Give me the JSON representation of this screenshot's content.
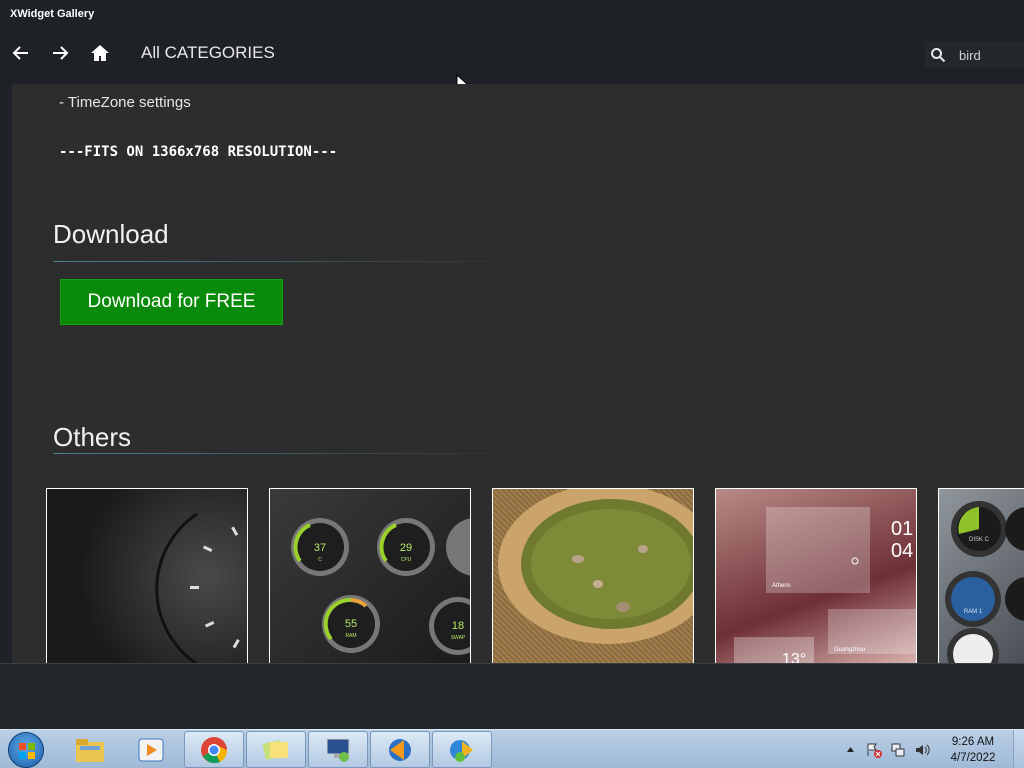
{
  "window": {
    "title": "XWidget Gallery"
  },
  "nav": {
    "category": "All CATEGORIES",
    "search_value": "bird"
  },
  "content": {
    "timezone_line": "- TimeZone settings",
    "resolution_line": "---FITS ON 1366x768 RESOLUTION---",
    "download_heading": "Download",
    "download_button": "Download for FREE",
    "others_heading": "Others",
    "thumbnails": [
      {
        "icon": "dark-clock-widget"
      },
      {
        "icon": "system-gauges-widget",
        "labels": [
          "37",
          "C",
          "29",
          "CPU",
          "55",
          "RAM",
          "18",
          "SWAP"
        ]
      },
      {
        "icon": "herbs-bowl-widget"
      },
      {
        "icon": "weather-clock-widget",
        "labels": [
          "Athens",
          "13°",
          "Guangzhou",
          "01",
          "04"
        ]
      },
      {
        "icon": "disk-meters-widget",
        "labels": [
          "DISK C",
          "RAM 1"
        ]
      }
    ]
  },
  "taskbar": {
    "items": [
      "start-button",
      "file-explorer-icon",
      "media-player-icon",
      "chrome-icon",
      "sticky-notes-icon",
      "remote-desktop-icon",
      "media-center-icon",
      "xwidget-icon"
    ],
    "clock_time": "9:26 AM",
    "clock_date": "4/7/2022"
  },
  "colors": {
    "download_green": "#0a8a0a",
    "bg": "#2d2d2d",
    "taskbar": "#b9cfe6"
  }
}
